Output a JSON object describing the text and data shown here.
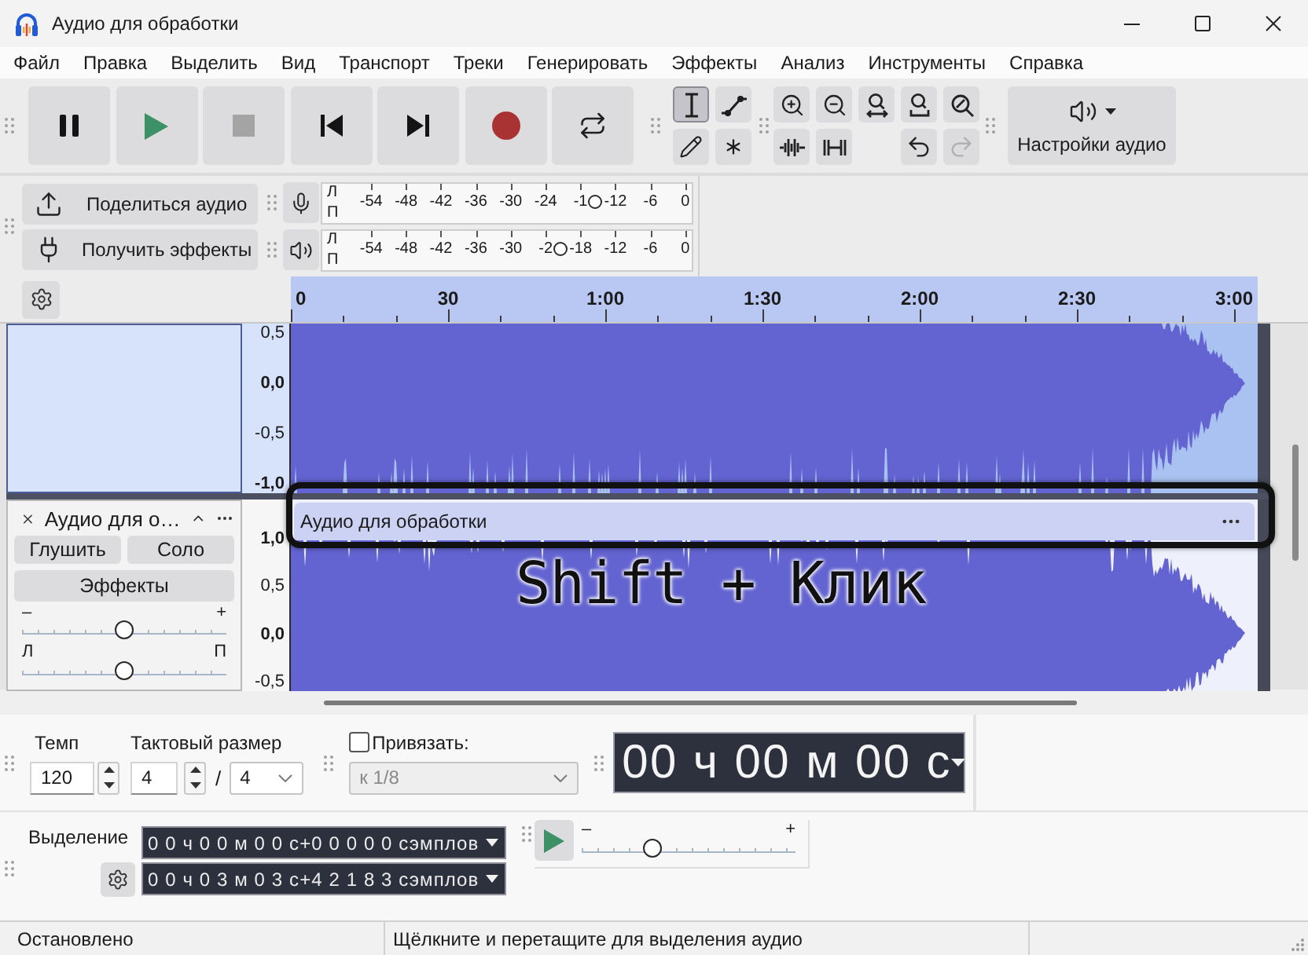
{
  "window": {
    "title": "Аудио для обработки"
  },
  "menu": [
    "Файл",
    "Правка",
    "Выделить",
    "Вид",
    "Транспорт",
    "Треки",
    "Генерировать",
    "Эффекты",
    "Анализ",
    "Инструменты",
    "Справка"
  ],
  "transport": [
    {
      "kind": "pause",
      "disabled": false
    },
    {
      "kind": "play",
      "disabled": false
    },
    {
      "kind": "stop",
      "disabled": true
    },
    {
      "kind": "skip_start",
      "disabled": false
    },
    {
      "kind": "skip_end",
      "disabled": false
    },
    {
      "kind": "record",
      "disabled": false
    },
    {
      "kind": "loop",
      "disabled": false
    }
  ],
  "tools": [
    {
      "kind": "select",
      "selected": true
    },
    {
      "kind": "envelope",
      "selected": false
    },
    {
      "kind": "draw",
      "selected": false
    },
    {
      "kind": "multi",
      "selected": false
    }
  ],
  "edit": [
    {
      "kind": "zoom_in",
      "disabled": false
    },
    {
      "kind": "zoom_out",
      "disabled": false
    },
    {
      "kind": "fit_selection",
      "disabled": false
    },
    {
      "kind": "fit_project",
      "disabled": false
    },
    {
      "kind": "zoom_toggle",
      "disabled": false
    },
    {
      "kind": "trim",
      "disabled": false
    },
    {
      "kind": "silence",
      "disabled": false
    },
    {
      "kind": "undo",
      "disabled": false
    },
    {
      "kind": "redo",
      "disabled": true
    }
  ],
  "audio_settings": {
    "label": "Настройки аудио"
  },
  "share": [
    {
      "kind": "share_audio",
      "label": "Поделиться аудио"
    },
    {
      "kind": "get_effects",
      "label": "Получить эффекты"
    }
  ],
  "meters": [
    {
      "kind": "recording",
      "channels": [
        "Л",
        "П"
      ],
      "scale": [
        "-54",
        "-48",
        "-42",
        "-36",
        "-30",
        "-24",
        "-1",
        "-12",
        "-6",
        "0"
      ],
      "level": 0.74
    },
    {
      "kind": "playback",
      "channels": [
        "Л",
        "П"
      ],
      "scale": [
        "-54",
        "-48",
        "-42",
        "-36",
        "-30",
        "-2",
        "-18",
        "-12",
        "-6",
        "0"
      ],
      "level": 0.646
    }
  ],
  "ruler": [
    "0",
    "30",
    "1:00",
    "1:30",
    "2:00",
    "2:30",
    "3:00"
  ],
  "tracks": [
    {
      "selected": true,
      "scale": [
        {
          "label": "0,5",
          "major": false
        },
        {
          "label": "0,0",
          "major": true
        },
        {
          "label": "-0,5",
          "major": false
        },
        {
          "label": "-1,0",
          "major": true
        }
      ]
    },
    {
      "selected": false,
      "name": "Аудио для о…",
      "mute": {
        "label": "Глушить",
        "on": false
      },
      "solo": {
        "label": "Соло",
        "on": false
      },
      "effects": "Эффекты",
      "gain": {
        "min": "–",
        "max": "+",
        "level": 0.5
      },
      "pan": {
        "min": "Л",
        "max": "П",
        "level": 0.5
      },
      "scale": [
        {
          "label": "1,0",
          "major": true
        },
        {
          "label": "0,5",
          "major": false
        },
        {
          "label": "0,0",
          "major": true
        },
        {
          "label": "-0,5",
          "major": false
        }
      ],
      "clip": {
        "name": "Аудио для обработки"
      }
    }
  ],
  "annotation": {
    "text": "Shift + Клик",
    "highlight": true
  },
  "tempo": {
    "label": "Темп",
    "value": "120"
  },
  "time_signature": {
    "label": "Тактовый размер",
    "upper": "4",
    "separator": "/",
    "lower": "4"
  },
  "snap": {
    "label": "Привязать:",
    "checked": false,
    "value": "к 1/8",
    "disabled": true
  },
  "time": {
    "value": "00 ч 00 м 00 с"
  },
  "selection": {
    "label": "Выделение",
    "start": "0 0 ч 0 0 м 0 0 с+0 0 0 0 0 сэмплов",
    "end": "0 0 ч 0 3 м 0 3 с+4 2 1 8 3 сэмплов"
  },
  "play_at_speed": {
    "min": "–",
    "max": "+",
    "level": 0.33
  },
  "status_bar": [
    "Остановлено",
    "Щёлкните и перетащите для выделения аудио"
  ]
}
